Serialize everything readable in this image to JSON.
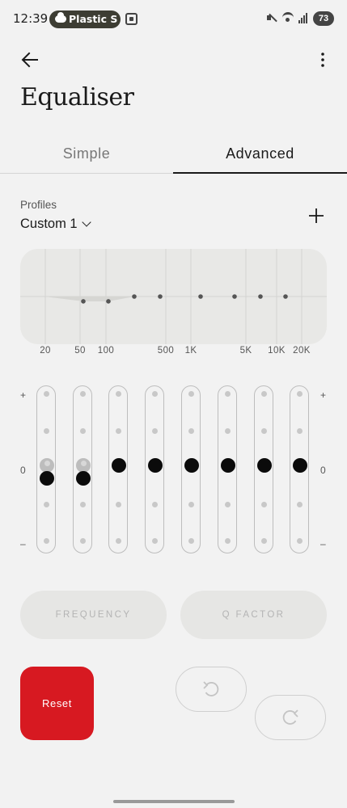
{
  "status_bar": {
    "time": "12:39",
    "notification_pill_text": "Plastic S",
    "battery_level": "73"
  },
  "header": {
    "title": "Equaliser"
  },
  "tabs": [
    {
      "label": "Simple",
      "selected": false
    },
    {
      "label": "Advanced",
      "selected": true
    }
  ],
  "profiles": {
    "label": "Profiles",
    "selected": "Custom 1"
  },
  "frequency_labels": [
    "20",
    "50",
    "100",
    "500",
    "1K",
    "5K",
    "10K",
    "20K"
  ],
  "sliders": {
    "plus_label": "+",
    "zero_label": "0",
    "minus_label": "–",
    "band_levels": [
      -0.33,
      -0.33,
      0,
      0,
      0,
      0,
      0,
      0
    ],
    "ghost_levels": [
      0,
      0,
      null,
      null,
      null,
      null,
      null,
      null
    ]
  },
  "buttons": {
    "frequency": "FREQUENCY",
    "q_factor": "Q FACTOR",
    "reset": "Reset"
  },
  "colors": {
    "accent_red": "#d71921",
    "background": "#f2f2f2",
    "knob": "#0b0b0b"
  }
}
